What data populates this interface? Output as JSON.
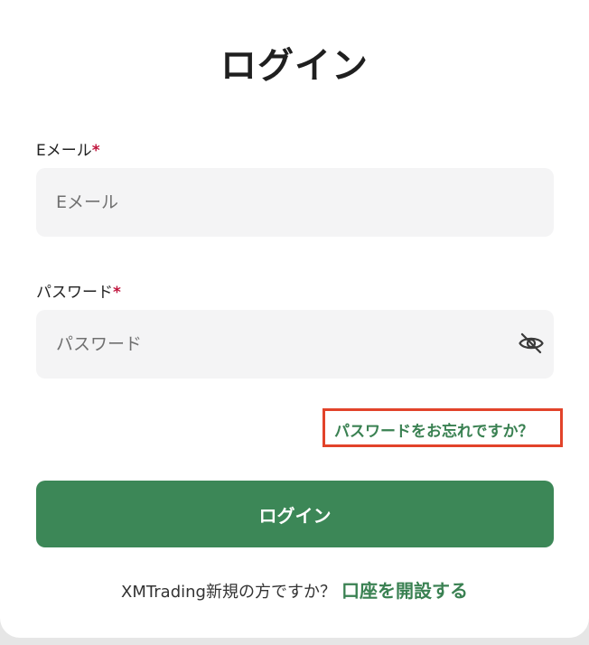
{
  "page": {
    "title": "ログイン"
  },
  "email": {
    "label": "Eメール",
    "required_mark": "*",
    "placeholder": "Eメール",
    "value": ""
  },
  "password": {
    "label": "パスワード",
    "required_mark": "*",
    "placeholder": "パスワード",
    "value": "",
    "toggle_icon": "eye-slash-icon"
  },
  "forgot_link": "パスワードをお忘れですか？",
  "login_button": "ログイン",
  "signup": {
    "prompt": "XMTrading新規の方ですか？",
    "link": "口座を開設する"
  },
  "colors": {
    "accent": "#3c8757",
    "link": "#3a8152",
    "required": "#c0143c",
    "highlight_box": "#e2432a"
  }
}
